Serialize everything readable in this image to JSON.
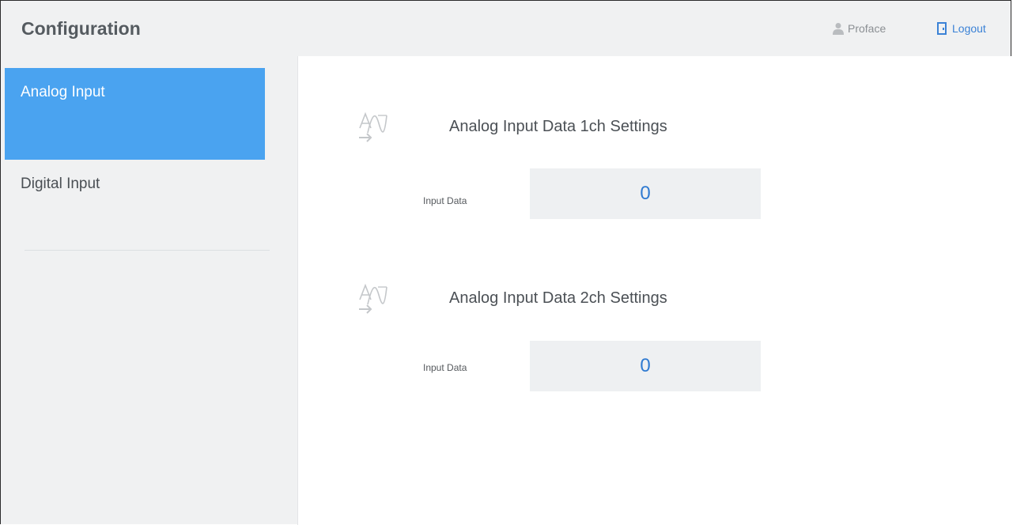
{
  "header": {
    "title": "Configuration",
    "user_name": "Proface",
    "logout_label": "Logout"
  },
  "sidebar": {
    "items": [
      {
        "label": "Analog Input",
        "active": true
      },
      {
        "label": "Digital Input",
        "active": false
      }
    ]
  },
  "main": {
    "sections": [
      {
        "title": "Analog Input Data 1ch Settings",
        "field_label": "Input Data",
        "value": "0",
        "icon": "analog-wave-icon"
      },
      {
        "title": "Analog Input Data 2ch Settings",
        "field_label": "Input Data",
        "value": "0",
        "icon": "analog-wave-icon"
      }
    ]
  },
  "colors": {
    "accent": "#4aa3f0",
    "value_text": "#2f7ad1",
    "link": "#3b82d6",
    "background": "#f0f1f2"
  }
}
